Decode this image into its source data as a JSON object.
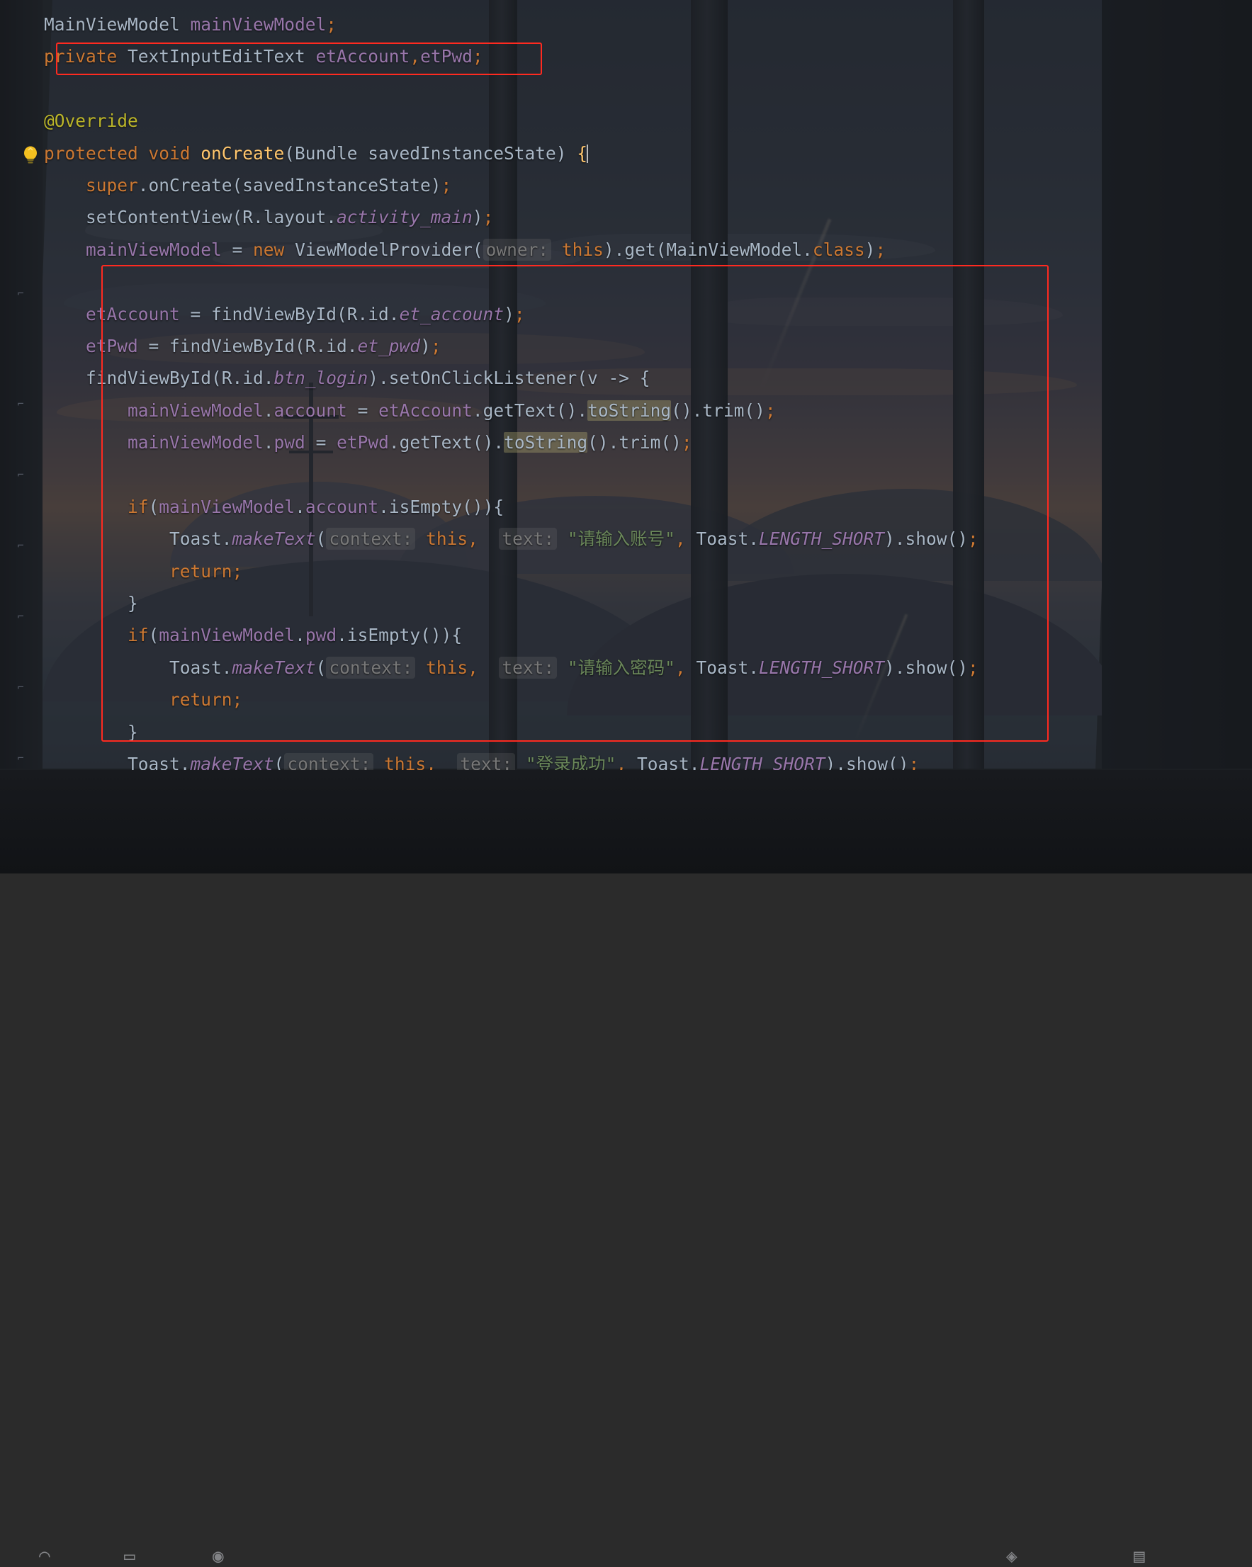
{
  "app": {
    "type": "code-editor",
    "theme": "darcula",
    "language": "java",
    "background_image": "anime-window-sunset-wallpaper"
  },
  "colors": {
    "editor_bg": "#2b2b2b",
    "default_text": "#a9b7c6",
    "keyword": "#cc7832",
    "annotation": "#bbb529",
    "method": "#ffc66d",
    "field": "#9876aa",
    "string": "#6a8759",
    "inlay_hint": "#787878",
    "highlight": "#c1ba76",
    "annotation_box": "#ff2a20",
    "caret": "#bbbbbb"
  },
  "gutter": {
    "bulb_icon": "lightbulb-intention-icon",
    "fold_markers": [
      "fold-marker",
      "fold-marker",
      "fold-marker",
      "fold-marker",
      "fold-marker",
      "fold-marker",
      "fold-marker"
    ]
  },
  "annotations": {
    "box1_label": "red-rectangle-field-declaration",
    "box2_label": "red-rectangle-onclick-block"
  },
  "code": {
    "lines": [
      {
        "id": "l1",
        "html": "<span class=\"plain\">MainViewModel </span><span class=\"fld\">mainViewModel</span><span class=\"semi\">;</span>"
      },
      {
        "id": "l2",
        "html": "<span class=\"kw\">private </span><span class=\"plain\">TextInputEditText </span><span class=\"fld\">etAccount</span><span class=\"semi\">,</span><span class=\"fld\">etPwd</span><span class=\"semi\">;</span>"
      },
      {
        "id": "l3",
        "html": ""
      },
      {
        "id": "l4",
        "html": "<span class=\"an\">@Override</span>"
      },
      {
        "id": "l5",
        "html": "<span class=\"kw\">protected void </span><span class=\"fn\">onCreate</span><span class=\"plain\">(Bundle savedInstanceState) </span><span class=\"fn\">{</span><span class=\"caret\"></span>"
      },
      {
        "id": "l6",
        "html": "    <span class=\"kw\">super</span><span class=\"plain\">.onCreate(savedInstanceState)</span><span class=\"semi\">;</span>"
      },
      {
        "id": "l7",
        "html": "    <span class=\"plain\">setContentView(R.layout.</span><span class=\"fldi\">activity_main</span><span class=\"plain\">)</span><span class=\"semi\">;</span>"
      },
      {
        "id": "l8",
        "html": "    <span class=\"fld\">mainViewModel </span><span class=\"plain\">= </span><span class=\"kw\">new </span><span class=\"plain\">ViewModelProvider(</span><span class=\"hint\">owner:</span><span class=\"plain\"> </span><span class=\"kw\">this</span><span class=\"plain\">).get(MainViewModel.</span><span class=\"kw\">class</span><span class=\"plain\">)</span><span class=\"semi\">;</span>"
      },
      {
        "id": "l9",
        "html": ""
      },
      {
        "id": "l10",
        "html": "    <span class=\"fld\">etAccount </span><span class=\"plain\">= findViewById(R.id.</span><span class=\"fldi\">et_account</span><span class=\"plain\">)</span><span class=\"semi\">;</span>"
      },
      {
        "id": "l11",
        "html": "    <span class=\"fld\">etPwd </span><span class=\"plain\">= findViewById(R.id.</span><span class=\"fldi\">et_pwd</span><span class=\"plain\">)</span><span class=\"semi\">;</span>"
      },
      {
        "id": "l12",
        "html": "    <span class=\"plain\">findViewById(R.id.</span><span class=\"fldi\">btn_login</span><span class=\"plain\">).setOnClickListener(v -&gt; {</span>"
      },
      {
        "id": "l13",
        "html": "        <span class=\"fld\">mainViewModel</span><span class=\"plain\">.</span><span class=\"fld\">account </span><span class=\"plain\">= </span><span class=\"fld\">etAccount</span><span class=\"plain\">.getText().</span><span class=\"hl\">toString</span><span class=\"plain\">().trim()</span><span class=\"semi\">;</span>"
      },
      {
        "id": "l14",
        "html": "        <span class=\"fld\">mainViewModel</span><span class=\"plain\">.</span><span class=\"fld\">pwd </span><span class=\"plain\">= </span><span class=\"fld\">etPwd</span><span class=\"plain\">.getText().</span><span class=\"hl\">toString</span><span class=\"plain\">().trim()</span><span class=\"semi\">;</span>"
      },
      {
        "id": "l15",
        "html": ""
      },
      {
        "id": "l16",
        "html": "        <span class=\"kw\">if</span><span class=\"plain\">(</span><span class=\"fld\">mainViewModel</span><span class=\"plain\">.</span><span class=\"fld\">account</span><span class=\"plain\">.isEmpty()){</span>"
      },
      {
        "id": "l17",
        "html": "            <span class=\"plain\">Toast.</span><span class=\"stat\">makeText</span><span class=\"plain\">(</span><span class=\"hint\">context:</span><span class=\"plain\"> </span><span class=\"kw\">this</span><span class=\"semi\">,</span><span class=\"plain\">  </span><span class=\"hint\">text:</span><span class=\"plain\"> </span><span class=\"str\">\"请输入账号\"</span><span class=\"semi\">,</span><span class=\"plain\"> Toast.</span><span class=\"stat\">LENGTH_SHORT</span><span class=\"plain\">).show()</span><span class=\"semi\">;</span>"
      },
      {
        "id": "l18",
        "html": "            <span class=\"kw\">return</span><span class=\"semi\">;</span>"
      },
      {
        "id": "l19",
        "html": "        <span class=\"plain\">}</span>"
      },
      {
        "id": "l20",
        "html": "        <span class=\"kw\">if</span><span class=\"plain\">(</span><span class=\"fld\">mainViewModel</span><span class=\"plain\">.</span><span class=\"fld\">pwd</span><span class=\"plain\">.isEmpty()){</span>"
      },
      {
        "id": "l21",
        "html": "            <span class=\"plain\">Toast.</span><span class=\"stat\">makeText</span><span class=\"plain\">(</span><span class=\"hint\">context:</span><span class=\"plain\"> </span><span class=\"kw\">this</span><span class=\"semi\">,</span><span class=\"plain\">  </span><span class=\"hint\">text:</span><span class=\"plain\"> </span><span class=\"str\">\"请输入密码\"</span><span class=\"semi\">,</span><span class=\"plain\"> Toast.</span><span class=\"stat\">LENGTH_SHORT</span><span class=\"plain\">).show()</span><span class=\"semi\">;</span>"
      },
      {
        "id": "l22",
        "html": "            <span class=\"kw\">return</span><span class=\"semi\">;</span>"
      },
      {
        "id": "l23",
        "html": "        <span class=\"plain\">}</span>"
      },
      {
        "id": "l24",
        "html": "        <span class=\"plain\">Toast.</span><span class=\"stat\">makeText</span><span class=\"plain\">(</span><span class=\"hint\">context:</span><span class=\"plain\"> </span><span class=\"kw\">this</span><span class=\"semi\">,</span><span class=\"plain\">  </span><span class=\"hint\">text:</span><span class=\"plain\"> </span><span class=\"str\">\"登录成功\"</span><span class=\"semi\">,</span><span class=\"plain\"> Toast.</span><span class=\"stat\">LENGTH_SHORT</span><span class=\"plain\">).show()</span><span class=\"semi\">;</span>"
      },
      {
        "id": "l25",
        "html": "    <span class=\"plain\">});</span>"
      },
      {
        "id": "l26",
        "html": "<span class=\"fn\">}</span>"
      }
    ],
    "plain_text": [
      "MainViewModel mainViewModel;",
      "private TextInputEditText etAccount,etPwd;",
      "",
      "@Override",
      "protected void onCreate(Bundle savedInstanceState) {",
      "    super.onCreate(savedInstanceState);",
      "    setContentView(R.layout.activity_main);",
      "    mainViewModel = new ViewModelProvider( owner: this).get(MainViewModel.class);",
      "",
      "    etAccount = findViewById(R.id.et_account);",
      "    etPwd = findViewById(R.id.et_pwd);",
      "    findViewById(R.id.btn_login).setOnClickListener(v -> {",
      "        mainViewModel.account = etAccount.getText().toString().trim();",
      "        mainViewModel.pwd = etPwd.getText().toString().trim();",
      "",
      "        if(mainViewModel.account.isEmpty()){",
      "            Toast.makeText( context: this,  text: \"请输入账号\", Toast.LENGTH_SHORT).show();",
      "            return;",
      "        }",
      "        if(mainViewModel.pwd.isEmpty()){",
      "            Toast.makeText( context: this,  text: \"请输入密码\", Toast.LENGTH_SHORT).show();",
      "            return;",
      "        }",
      "        Toast.makeText( context: this,  text: \"登录成功\", Toast.LENGTH_SHORT).show();",
      "    });",
      "}"
    ]
  }
}
